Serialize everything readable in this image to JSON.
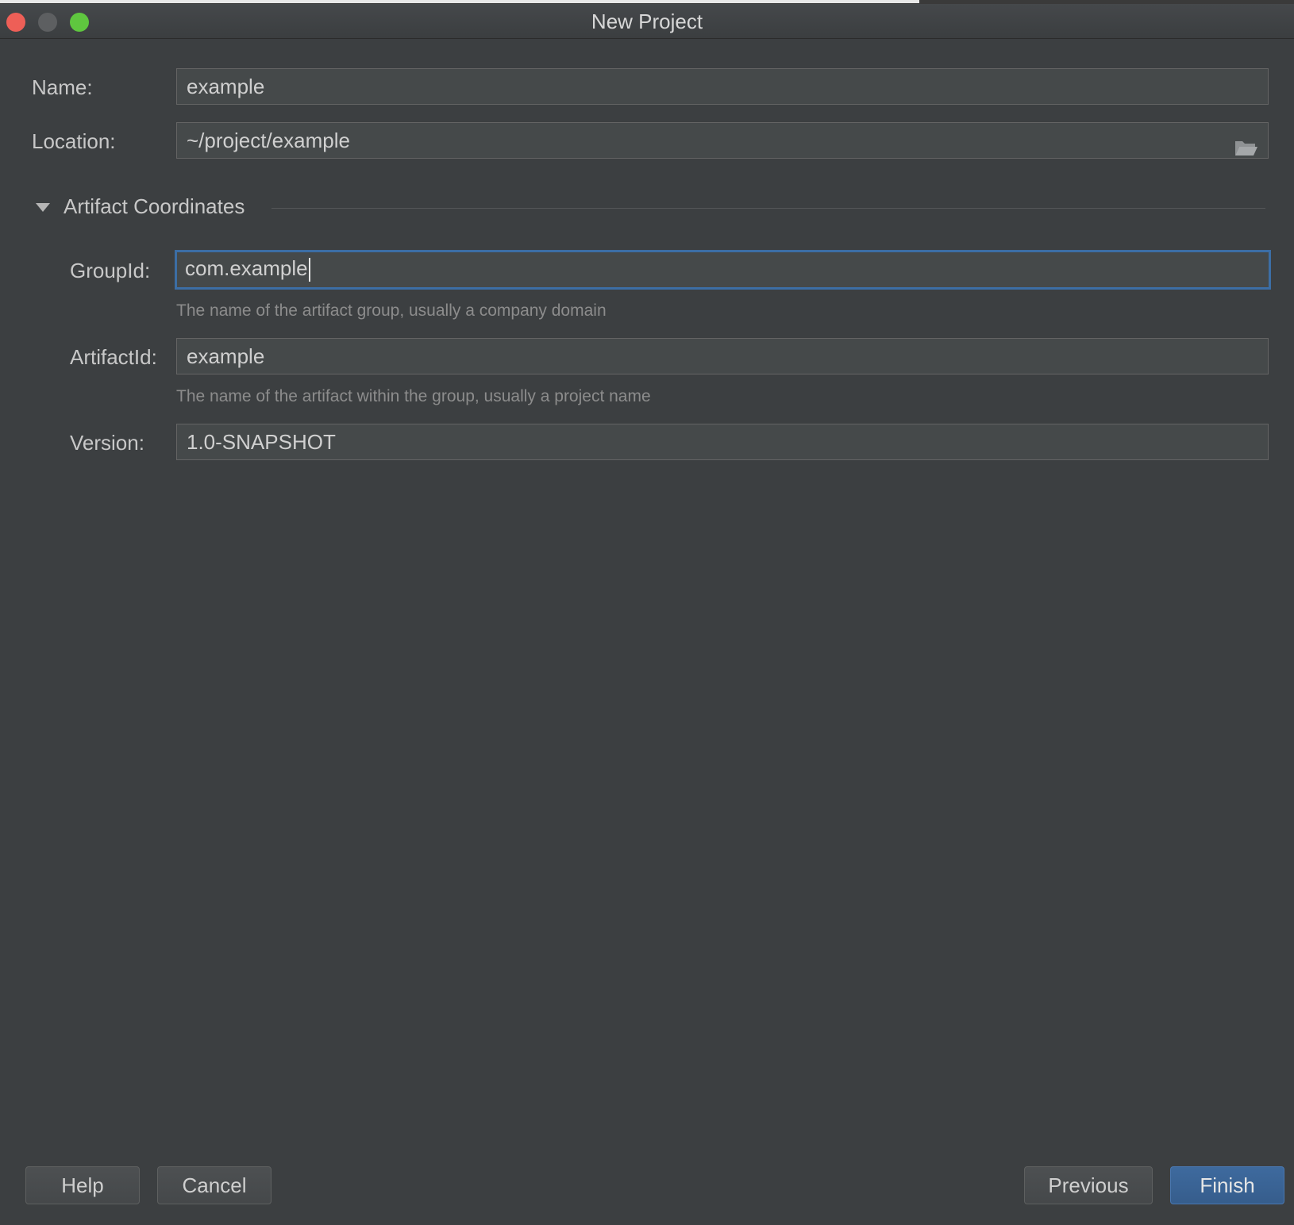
{
  "window": {
    "title": "New Project"
  },
  "form": {
    "name": {
      "label": "Name:",
      "value": "example"
    },
    "location": {
      "label": "Location:",
      "value": "~/project/example"
    }
  },
  "artifact": {
    "section_title": "Artifact Coordinates",
    "group_id": {
      "label": "GroupId:",
      "value": "com.example",
      "hint": "The name of the artifact group, usually a company domain"
    },
    "artifact_id": {
      "label": "ArtifactId:",
      "value": "example",
      "hint": "The name of the artifact within the group, usually a project name"
    },
    "version": {
      "label": "Version:",
      "value": "1.0-SNAPSHOT"
    }
  },
  "buttons": {
    "help": "Help",
    "cancel": "Cancel",
    "previous": "Previous",
    "finish": "Finish"
  },
  "colors": {
    "background": "#3c3f41",
    "focus_border": "#3c6ea5",
    "primary_button": "#365d8c"
  },
  "icons": [
    "close-traffic-light",
    "minimize-traffic-light",
    "maximize-traffic-light",
    "folder-icon",
    "triangle-down-icon"
  ]
}
